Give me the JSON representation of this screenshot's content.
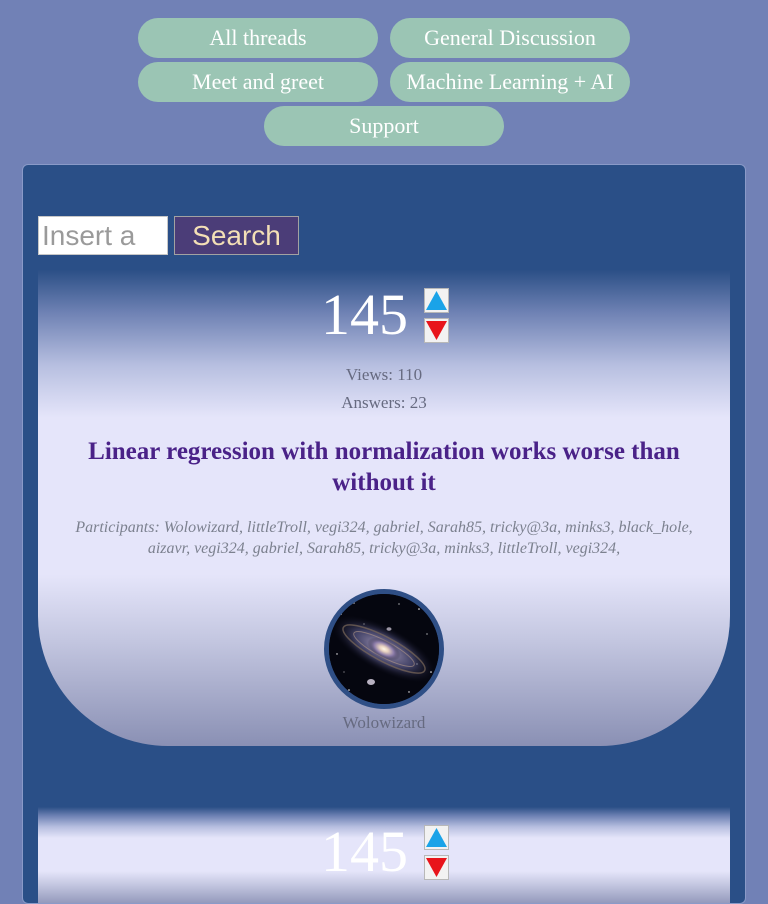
{
  "nav": {
    "items": [
      {
        "label": "All threads"
      },
      {
        "label": "General Discussion"
      },
      {
        "label": "Meet and greet"
      },
      {
        "label": "Machine Learning + AI"
      },
      {
        "label": "Support"
      }
    ]
  },
  "search": {
    "placeholder": "Insert a",
    "button_label": "Search"
  },
  "threads": [
    {
      "score": "145",
      "views": "Views: 110",
      "answers": "Answers: 23",
      "title": "Linear regression with normalization works worse than without it",
      "participants": "Participants: Wolowizard, littleTroll, vegi324, gabriel, Sarah85, tricky@3a, minks3, black_hole, aizavr, vegi324, gabriel, Sarah85, tricky@3a, minks3, littleTroll, vegi324,",
      "author": "Wolowizard"
    },
    {
      "score": "145"
    }
  ],
  "colors": {
    "page_bg": "#7181b6",
    "panel_bg": "#2a4f87",
    "pill_bg": "#9bc5b4",
    "search_button_bg": "#4b3d78",
    "title_color": "#4a2288",
    "upvote": "#1aa3e8",
    "downvote": "#e8141b"
  },
  "icons": {
    "upvote": "triangle-up-icon",
    "downvote": "triangle-down-icon",
    "avatar": "galaxy-avatar"
  }
}
